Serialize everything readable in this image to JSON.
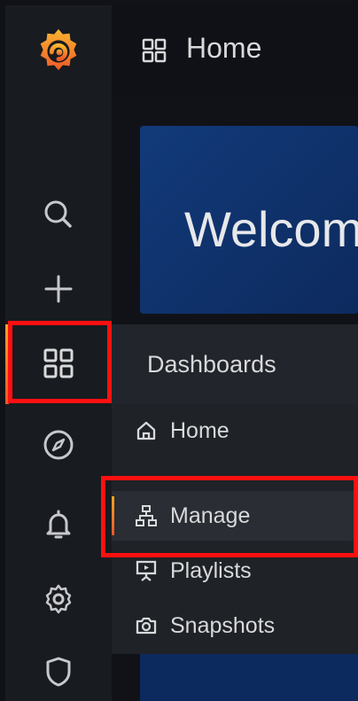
{
  "header": {
    "title": "Home",
    "icon": "grid-icon"
  },
  "banner": {
    "text": "Welcom"
  },
  "sidebar": {
    "items": [
      {
        "name": "grafana-logo",
        "icon": "grafana-logo"
      },
      {
        "name": "search",
        "icon": "search-icon"
      },
      {
        "name": "create",
        "icon": "plus-icon"
      },
      {
        "name": "dashboards",
        "icon": "grid-icon",
        "active": true
      },
      {
        "name": "explore",
        "icon": "compass-icon"
      },
      {
        "name": "alerting",
        "icon": "bell-icon"
      },
      {
        "name": "configuration",
        "icon": "gear-icon"
      },
      {
        "name": "server-admin",
        "icon": "shield-icon"
      }
    ]
  },
  "menu": {
    "title": "Dashboards",
    "items": [
      {
        "label": "Home",
        "icon": "home-icon"
      },
      {
        "label": "Manage",
        "icon": "sitemap-icon",
        "active": true
      },
      {
        "label": "Playlists",
        "icon": "presentation-icon"
      },
      {
        "label": "Snapshots",
        "icon": "camera-icon"
      }
    ]
  },
  "colors": {
    "background": "#111217",
    "sidebar": "#181b1f",
    "menu": "#1f2227",
    "banner": "#123a7a",
    "accent": "#f5a623",
    "highlight": "#ff1010"
  }
}
